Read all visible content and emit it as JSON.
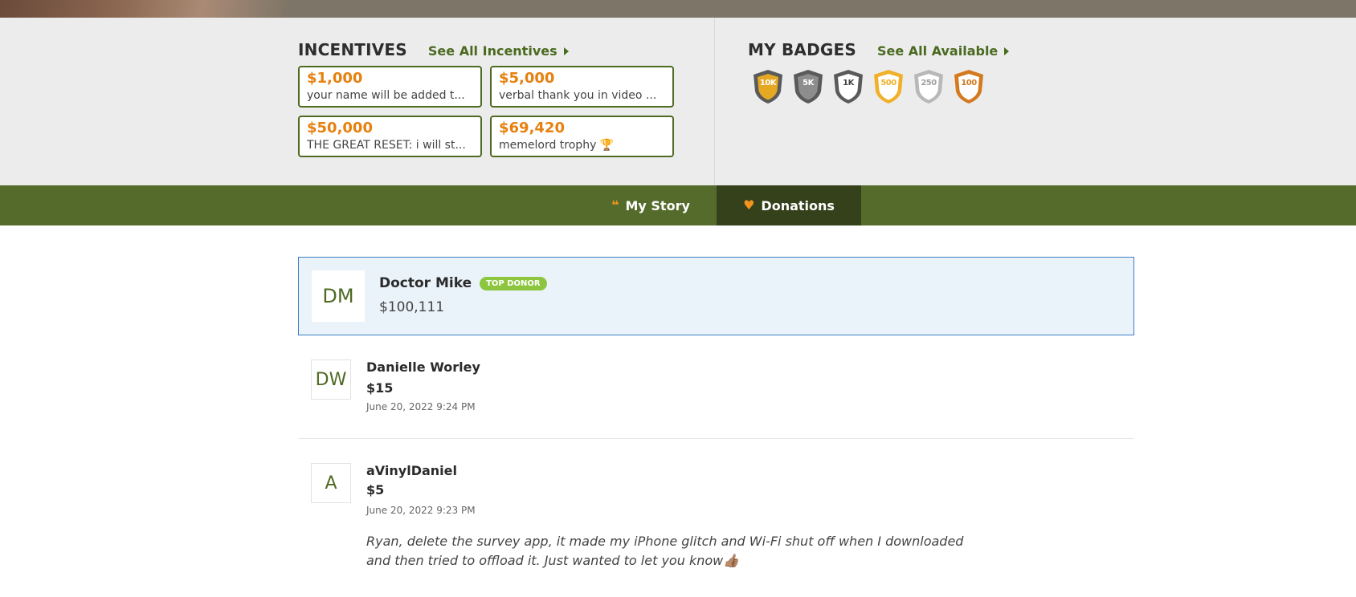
{
  "incentives_section": {
    "title": "INCENTIVES",
    "see_all_label": "See All Incentives",
    "items": [
      {
        "amount": "$1,000",
        "description": "your name will be added t..."
      },
      {
        "amount": "$5,000",
        "description": "verbal thank you in video ..."
      },
      {
        "amount": "$50,000",
        "description": "THE GREAT RESET: i will st..."
      },
      {
        "amount": "$69,420",
        "description": "memelord trophy 🏆"
      }
    ]
  },
  "badges_section": {
    "title": "MY BADGES",
    "see_all_label": "See All Available",
    "badges": [
      {
        "label": "10K",
        "fill": "#e5a823",
        "rim": "#5a5a5a",
        "text_color": "#ffffff"
      },
      {
        "label": "5K",
        "fill": "#8d8d8d",
        "rim": "#5a5a5a",
        "text_color": "#ffffff"
      },
      {
        "label": "1K",
        "fill": "#ffffff",
        "rim": "#5a5a5a",
        "text_color": "#444444"
      },
      {
        "label": "500",
        "fill": "#ffffff",
        "rim": "#f0b02a",
        "text_color": "#f0b02a"
      },
      {
        "label": "250",
        "fill": "#ffffff",
        "rim": "#b8b8b8",
        "text_color": "#a0a0a0"
      },
      {
        "label": "100",
        "fill": "#ffffff",
        "rim": "#d37a1f",
        "text_color": "#d37a1f"
      }
    ]
  },
  "tabs": [
    {
      "label": "My Story",
      "icon": "quote-icon",
      "active": false
    },
    {
      "label": "Donations",
      "icon": "heart-icon",
      "active": true
    }
  ],
  "top_donor": {
    "initials": "DM",
    "name": "Doctor Mike",
    "badge": "TOP DONOR",
    "amount": "$100,111"
  },
  "donations": [
    {
      "initials": "DW",
      "name": "Danielle Worley",
      "amount": "$15",
      "date": "June 20, 2022 9:24 PM",
      "message": ""
    },
    {
      "initials": "A",
      "name": "aVinylDaniel",
      "amount": "$5",
      "date": "June 20, 2022 9:23 PM",
      "message": "Ryan, delete the survey app, it made my iPhone glitch and Wi-Fi shut off when I downloaded and then tried to offload it. Just wanted to let you know👍🏽"
    }
  ],
  "colors": {
    "accent_green": "#556b2c",
    "active_tab": "#34411a",
    "incentive_amount": "#e6800e",
    "top_donor_badge": "#8cc63f"
  }
}
